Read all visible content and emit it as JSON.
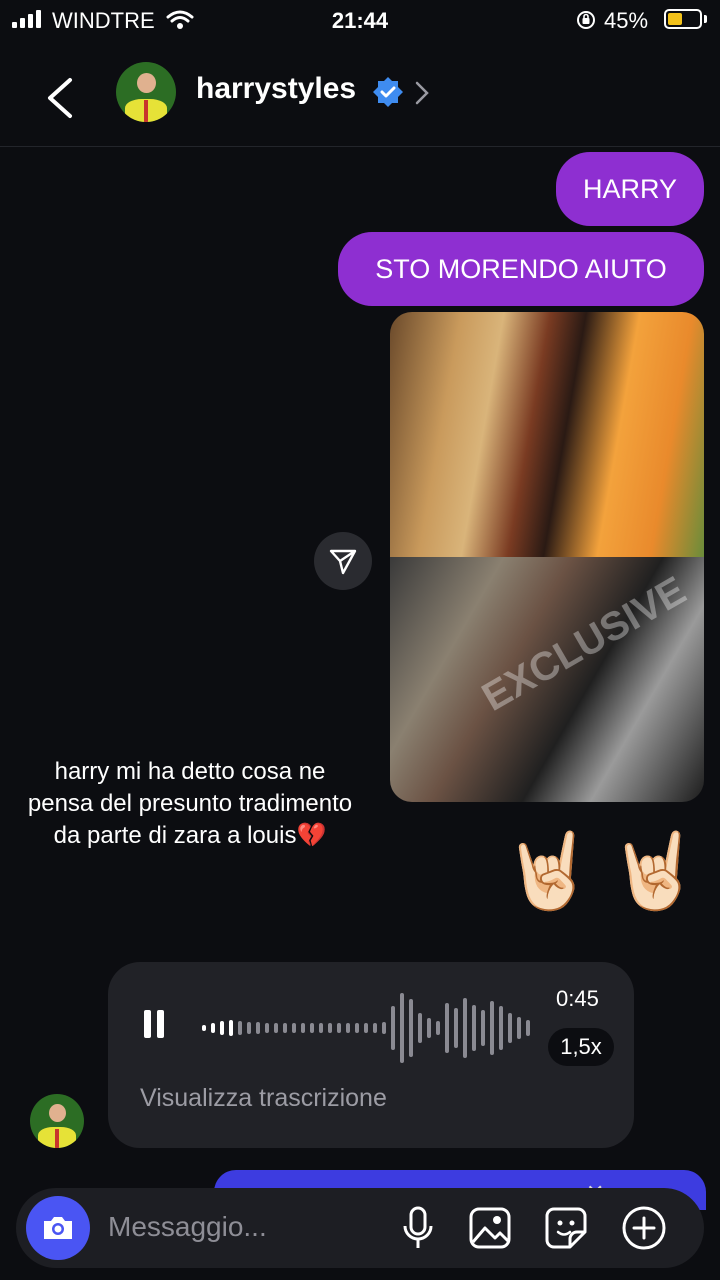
{
  "status_bar": {
    "carrier": "WINDTRE",
    "time": "21:44",
    "battery": "45%",
    "battery_level": 0.45,
    "battery_color": "#f3c21b"
  },
  "header": {
    "username": "harrystyles",
    "verified": true,
    "verified_color": "#3f8cf0"
  },
  "messages": {
    "sent_1": "HARRY",
    "sent_2": "STO MORENDO AIUTO",
    "photo_watermark": "EXCLUSIVE",
    "emoji_1": "🤘🏻",
    "emoji_2": "🤘🏻"
  },
  "overlay_caption": "harry mi ha detto cosa ne pensa del presunto tradimento da parte di zara a louis💔",
  "voice_message": {
    "duration": "0:45",
    "speed": "1,5x",
    "transcript_link": "Visualizza trascrizione",
    "state": "playing"
  },
  "composer": {
    "placeholder": "Messaggio..."
  },
  "colors": {
    "sent_bubble": "#8e2fd1",
    "camera_button": "#4a55f3",
    "background": "#0c0d11"
  },
  "icons": [
    "back-arrow-icon",
    "verified-badge-icon",
    "chevron-right-icon",
    "share-icon",
    "pause-icon",
    "camera-icon",
    "microphone-icon",
    "gallery-icon",
    "sticker-icon",
    "plus-icon",
    "close-icon"
  ]
}
